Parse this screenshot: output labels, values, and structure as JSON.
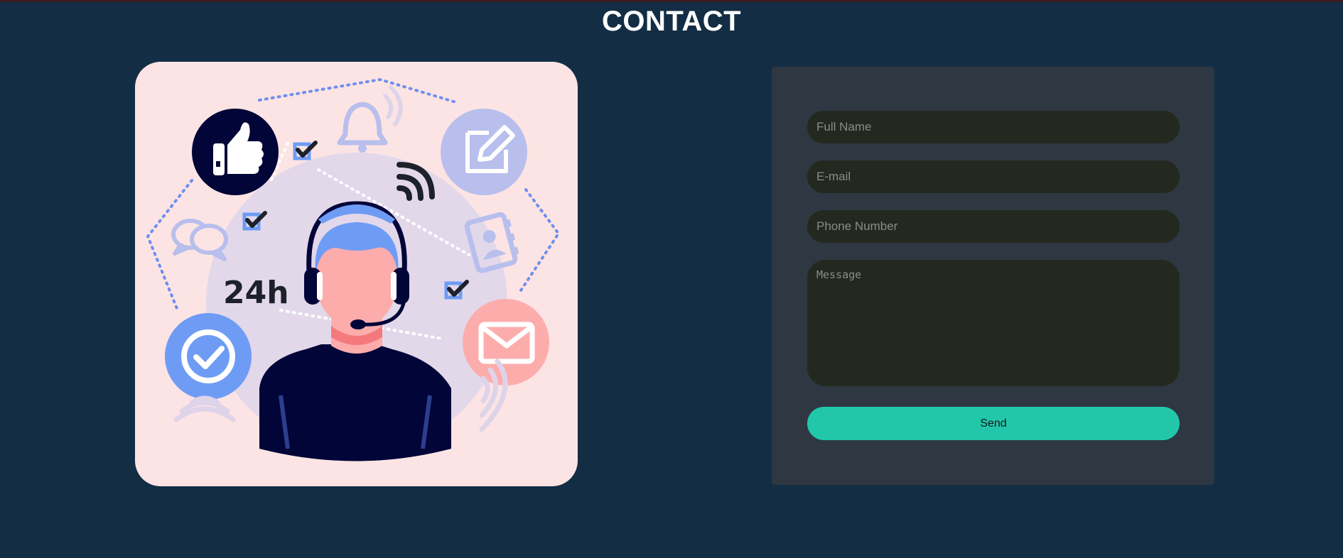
{
  "page": {
    "title": "CONTACT"
  },
  "illustration": {
    "badge_text": "24h",
    "icons": [
      "thumbs-up-icon",
      "edit-icon",
      "checkmark-circle-icon",
      "envelope-icon",
      "chat-bubbles-icon",
      "bell-icon",
      "wifi-signal-icon",
      "contact-book-icon",
      "checkbox-icon",
      "headset-agent-icon"
    ]
  },
  "form": {
    "full_name": {
      "placeholder": "Full Name",
      "value": ""
    },
    "email": {
      "placeholder": "E-mail",
      "value": ""
    },
    "phone": {
      "placeholder": "Phone Number",
      "value": ""
    },
    "message": {
      "placeholder": "Message",
      "value": ""
    },
    "send_label": "Send"
  },
  "colors": {
    "background": "#132d45",
    "card": "#fde4e4",
    "panel": "#2e3742",
    "field": "#24291f",
    "accent": "#22c7aa",
    "navy": "#020538",
    "periwinkle": "#b8bfed",
    "blue": "#6e9cf5",
    "pink": "#fdacac"
  }
}
